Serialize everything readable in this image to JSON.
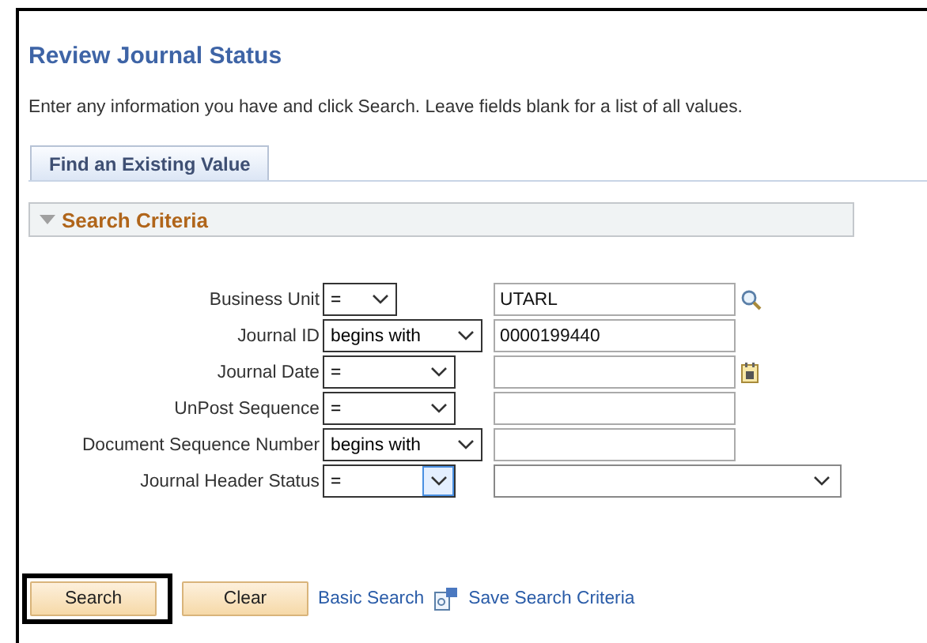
{
  "page": {
    "title": "Review Journal Status",
    "instructions": "Enter any information you have and click Search. Leave fields blank for a list of all values."
  },
  "tabs": [
    {
      "label": "Find an Existing Value",
      "selected": true
    }
  ],
  "section": {
    "title": "Search Criteria",
    "expanded": true
  },
  "criteria": [
    {
      "label": "Business Unit",
      "operator": "=",
      "focused": false,
      "kind": "lookup",
      "value": "UTARL"
    },
    {
      "label": "Journal ID",
      "operator": "begins with",
      "focused": false,
      "kind": "text",
      "value": "0000199440"
    },
    {
      "label": "Journal Date",
      "operator": "=",
      "focused": false,
      "kind": "date"
    },
    {
      "label": "UnPost Sequence",
      "operator": "=",
      "focused": false,
      "kind": "text"
    },
    {
      "label": "Document Sequence Number",
      "operator": "begins with",
      "focused": false,
      "kind": "text"
    },
    {
      "label": "Journal Header Status",
      "operator": "=",
      "focused": true,
      "kind": "select"
    }
  ],
  "actions": [
    {
      "kind": "button",
      "label": "Search",
      "highlighted": true
    },
    {
      "kind": "button",
      "label": "Clear",
      "highlighted": false
    },
    {
      "kind": "link",
      "label": "Basic Search"
    },
    {
      "kind": "icon-link",
      "label": "Save Search Criteria"
    }
  ]
}
